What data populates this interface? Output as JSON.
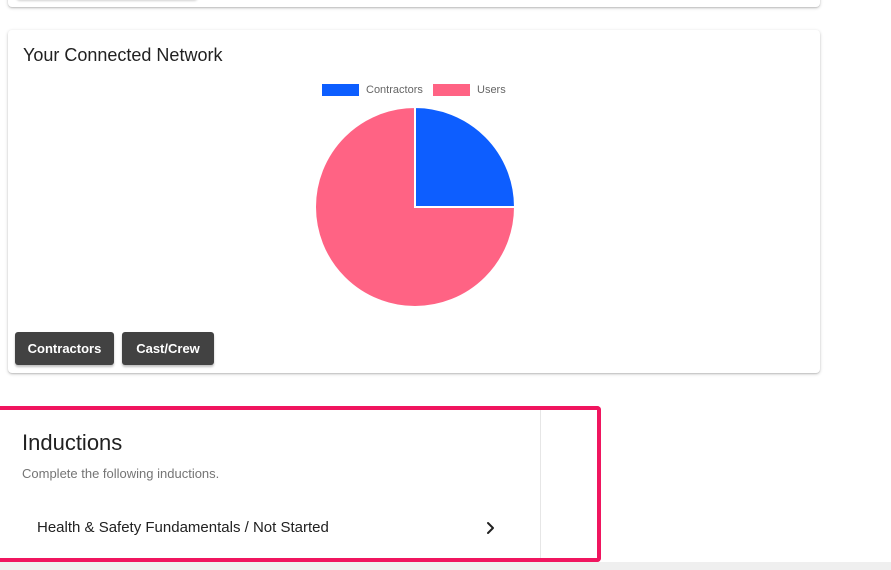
{
  "network": {
    "title": "Your Connected Network",
    "buttons": {
      "contractors": "Contractors",
      "cast_crew": "Cast/Crew"
    }
  },
  "chart_data": {
    "type": "pie",
    "labels": [
      "Contractors",
      "Users"
    ],
    "values": [
      25,
      75
    ],
    "colors": [
      "#0d5eff",
      "#ff6384"
    ],
    "legend_position": "top"
  },
  "inductions": {
    "title": "Inductions",
    "subtitle": "Complete the following inductions.",
    "items": [
      {
        "label": "Health & Safety Fundamentals / Not Started"
      }
    ]
  },
  "colors": {
    "highlight": "#f0155f",
    "button_bg": "#424242"
  }
}
